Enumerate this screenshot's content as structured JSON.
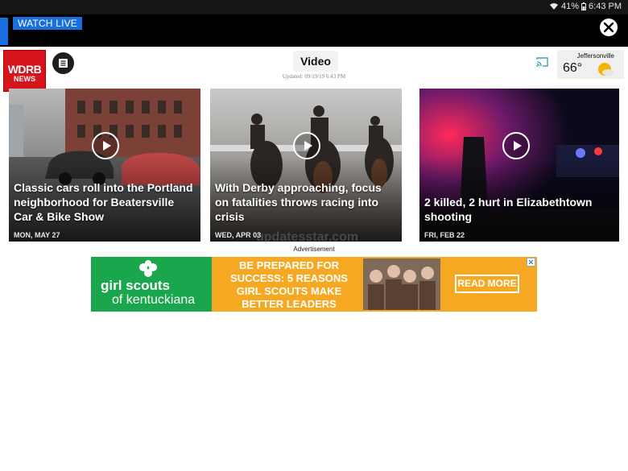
{
  "status_bar": {
    "battery": "41%",
    "time": "6:43 PM"
  },
  "live_bar": {
    "badge": "WATCH LIVE",
    "close_icon": "close-icon"
  },
  "header": {
    "logo_line1": "WDRB",
    "logo_line2": "NEWS",
    "title": "Video",
    "updated": "Updated: 09/19/19 6:43 PM",
    "weather": {
      "location": "Jeffersonville",
      "temp": "66°",
      "icon": "sun-icon"
    }
  },
  "cards": [
    {
      "title": "Classic cars roll into the Portland neighborhood for Beatersville Car & Bike Show",
      "date": "MON, MAY 27"
    },
    {
      "title": "With Derby approaching, focus on fatalities throws racing into crisis",
      "date": "WED, APR 03"
    },
    {
      "title": "2 killed, 2 hurt in Elizabethtown shooting",
      "date": "FRI, FEB 22"
    }
  ],
  "watermark": "updatesstar.com",
  "ad": {
    "label": "Advertisement",
    "brand_line1": "girl scouts",
    "brand_line2": "of kentuckiana",
    "headline": "BE PREPARED FOR SUCCESS: 5 REASONS GIRL SCOUTS MAKE BETTER LEADERS",
    "cta": "READ MORE"
  },
  "colors": {
    "accent": "#1a6fe0",
    "logo": "#d6141c",
    "ad_green": "#1aa64d",
    "ad_orange": "#f7a823"
  }
}
